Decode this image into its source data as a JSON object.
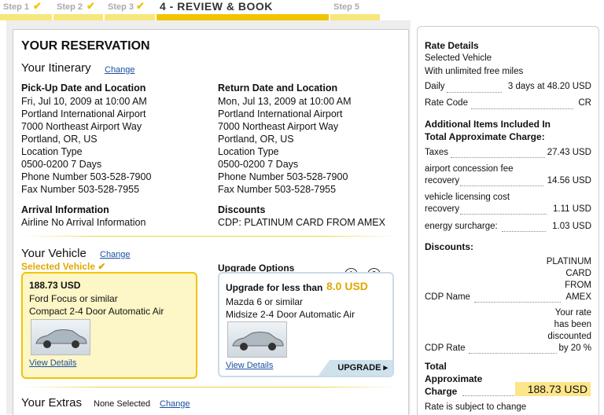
{
  "steps": [
    {
      "label": "Step 1",
      "check": "✔"
    },
    {
      "label": "Step 2",
      "check": "✔"
    },
    {
      "label": "Step 3",
      "check": "✔"
    },
    {
      "label": "4 - REVIEW & BOOK"
    },
    {
      "label": "Step 5"
    }
  ],
  "reservation": {
    "title": "YOUR RESERVATION",
    "itinerary_title": "Your Itinerary",
    "change": "Change",
    "pickup": {
      "heading": "Pick-Up Date and Location",
      "lines": [
        "Fri, Jul 10, 2009 at 10:00 AM",
        "Portland International Airport",
        "7000 Northeast Airport Way",
        "Portland, OR, US",
        "Location Type",
        "0500-0200 7 Days",
        "Phone Number 503-528-7900",
        "Fax Number 503-528-7955"
      ]
    },
    "return": {
      "heading": "Return Date and Location",
      "lines": [
        "Mon, Jul 13, 2009 at 10:00 AM",
        "Portland International Airport",
        "7000 Northeast Airport Way",
        "Portland, OR, US",
        "Location Type",
        "0500-0200 7 Days",
        "Phone Number 503-528-7900",
        "Fax Number 503-528-7955"
      ]
    },
    "arrival": {
      "heading": "Arrival Information",
      "text": "Airline No Arrival Information"
    },
    "discounts": {
      "heading": "Discounts",
      "text": "CDP: PLATINUM CARD FROM AMEX"
    },
    "vehicle_title": "Your Vehicle",
    "selected_vehicle": "Selected Vehicle ✔",
    "vehicle": {
      "price": "188.73  USD",
      "model": "Ford Focus or similar",
      "class": "Compact 2-4 Door Automatic Air",
      "details": "View Details"
    },
    "upgrade_title": "Upgrade Options",
    "upgrade": {
      "pages": [
        "1",
        "2"
      ],
      "lead": "Upgrade for less than",
      "price": "8.0 USD",
      "model": "Mazda 6 or similar",
      "class": "Midsize 2-4 Door Automatic Air",
      "details": "View Details",
      "button": "UPGRADE ▸"
    },
    "extras_title": "Your Extras",
    "extras_value": "None Selected"
  },
  "rates": {
    "title": "Rate Details",
    "selected": "Selected Vehicle",
    "miles": "With unlimited free miles",
    "daily_label": "Daily",
    "daily_value": "3 days at 48.20 USD",
    "code_label": "Rate Code",
    "code_value": "CR",
    "additional_title_1": "Additional Items Included In",
    "additional_title_2": "Total Approximate Charge:",
    "taxes_label": "Taxes",
    "taxes_value": "27.43 USD",
    "airport_label_1": "airport concession fee",
    "airport_label_2": "recovery",
    "airport_value": "14.56 USD",
    "vlc_label_1": "vehicle licensing cost",
    "vlc_label_2": "recovery",
    "vlc_value": "1.11 USD",
    "energy_label": "energy surcharge:",
    "energy_value": "1.03 USD",
    "discounts_title": "Discounts:",
    "cdp_name_label": "CDP Name",
    "cdp_name_lines": [
      "PLATINUM",
      "CARD",
      "FROM",
      "AMEX"
    ],
    "rate_note_lines": [
      "Your rate",
      "has been",
      "discounted"
    ],
    "cdp_rate_label": "CDP Rate",
    "cdp_rate_value": "by 20 %",
    "total_lines": [
      "Total",
      "Approximate",
      "Charge"
    ],
    "total_value": "188.73 USD",
    "subject": "Rate is subject to change"
  },
  "colors": {
    "accent": "#f1c400",
    "link": "#1a4fa3"
  }
}
